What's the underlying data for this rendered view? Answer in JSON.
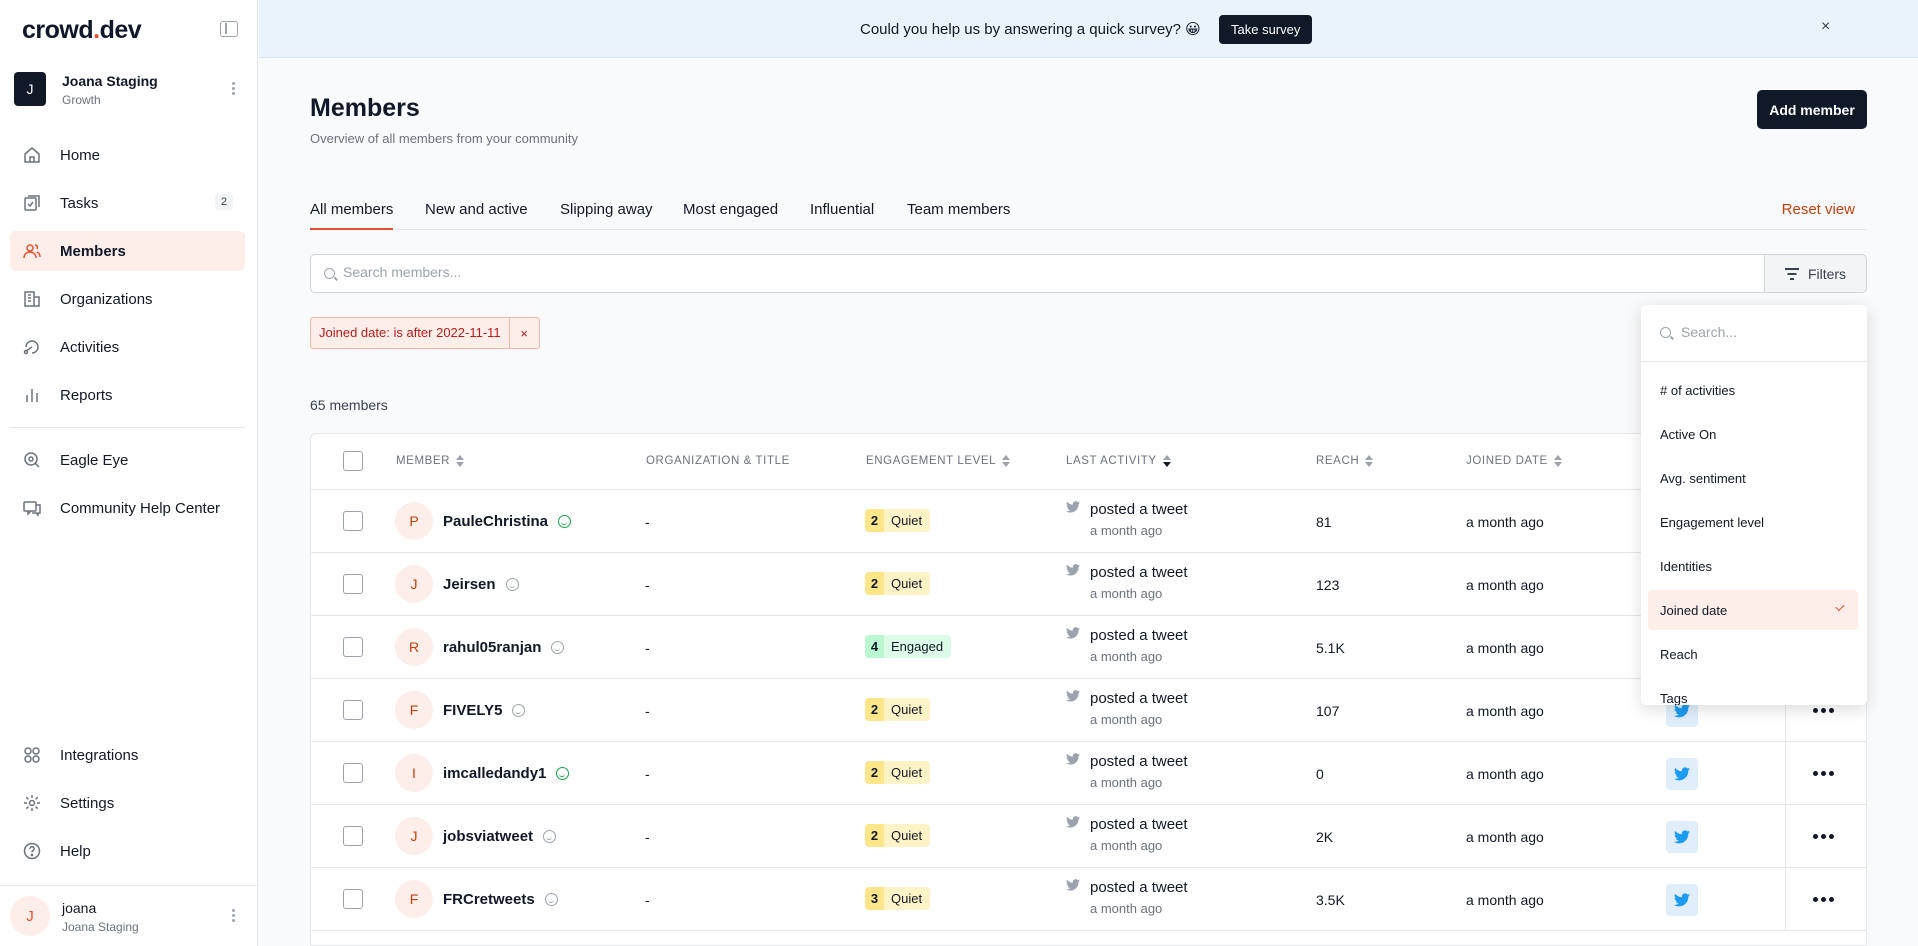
{
  "brand": {
    "logo_main": "crowd",
    "logo_dot": ".",
    "logo_tail": "dev",
    "accent": "#e94f2e"
  },
  "workspace": {
    "initial": "J",
    "name": "Joana Staging",
    "plan": "Growth"
  },
  "sidebar": {
    "items": [
      {
        "label": "Home",
        "icon": "home-icon"
      },
      {
        "label": "Tasks",
        "icon": "tasks-icon",
        "badge": "2"
      },
      {
        "label": "Members",
        "icon": "members-icon",
        "active": true
      },
      {
        "label": "Organizations",
        "icon": "organizations-icon"
      },
      {
        "label": "Activities",
        "icon": "activities-icon"
      },
      {
        "label": "Reports",
        "icon": "reports-icon"
      },
      {
        "label": "Eagle Eye",
        "icon": "eagle-eye-icon"
      },
      {
        "label": "Community Help Center",
        "icon": "help-center-icon"
      },
      {
        "label": "Integrations",
        "icon": "integrations-icon"
      },
      {
        "label": "Settings",
        "icon": "settings-icon"
      },
      {
        "label": "Help",
        "icon": "help-icon"
      }
    ]
  },
  "user": {
    "initial": "J",
    "name": "joana",
    "workspace": "Joana Staging"
  },
  "banner": {
    "text": "Could you help us by answering a quick survey? 😀",
    "button": "Take survey",
    "close": "×"
  },
  "header": {
    "title": "Members",
    "subtitle": "Overview of all members from your community",
    "add_button": "Add member"
  },
  "tabs": [
    "All members",
    "New and active",
    "Slipping away",
    "Most engaged",
    "Influential",
    "Team members"
  ],
  "reset_view": "Reset view",
  "search": {
    "placeholder": "Search members...",
    "filters_label": "Filters"
  },
  "active_filter": {
    "label": "Joined date:",
    "value": "is after 2022-11-11",
    "remove": "×"
  },
  "member_count": "65 members",
  "table": {
    "headers": {
      "member": "MEMBER",
      "organization": "ORGANIZATION & TITLE",
      "engagement": "ENGAGEMENT LEVEL",
      "last_activity": "LAST ACTIVITY",
      "reach": "REACH",
      "joined": "JOINED DATE"
    },
    "rows": [
      {
        "initial": "P",
        "name": "PauleChristina",
        "sentiment": "positive",
        "org": "-",
        "eng_num": "2",
        "eng_label": "Quiet",
        "activity": "posted a tweet",
        "activity_time": "a month ago",
        "reach": "81",
        "joined": "a month ago"
      },
      {
        "initial": "J",
        "name": "Jeirsen",
        "sentiment": "neutral",
        "org": "-",
        "eng_num": "2",
        "eng_label": "Quiet",
        "activity": "posted a tweet",
        "activity_time": "a month ago",
        "reach": "123",
        "joined": "a month ago"
      },
      {
        "initial": "R",
        "name": "rahul05ranjan",
        "sentiment": "neutral",
        "org": "-",
        "eng_num": "4",
        "eng_label": "Engaged",
        "activity": "posted a tweet",
        "activity_time": "a month ago",
        "reach": "5.1K",
        "joined": "a month ago"
      },
      {
        "initial": "F",
        "name": "FIVELY5",
        "sentiment": "neutral",
        "org": "-",
        "eng_num": "2",
        "eng_label": "Quiet",
        "activity": "posted a tweet",
        "activity_time": "a month ago",
        "reach": "107",
        "joined": "a month ago"
      },
      {
        "initial": "I",
        "name": "imcalledandy1",
        "sentiment": "positive",
        "org": "-",
        "eng_num": "2",
        "eng_label": "Quiet",
        "activity": "posted a tweet",
        "activity_time": "a month ago",
        "reach": "0",
        "joined": "a month ago"
      },
      {
        "initial": "J",
        "name": "jobsviatweet",
        "sentiment": "neutral",
        "org": "-",
        "eng_num": "2",
        "eng_label": "Quiet",
        "activity": "posted a tweet",
        "activity_time": "a month ago",
        "reach": "2K",
        "joined": "a month ago"
      },
      {
        "initial": "F",
        "name": "FRCretweets",
        "sentiment": "neutral",
        "org": "-",
        "eng_num": "3",
        "eng_label": "Quiet",
        "activity": "posted a tweet",
        "activity_time": "a month ago",
        "reach": "3.5K",
        "joined": "a month ago"
      }
    ]
  },
  "filter_dropdown": {
    "placeholder": "Search...",
    "options": [
      "# of activities",
      "Active On",
      "Avg. sentiment",
      "Engagement level",
      "Identities",
      "Joined date",
      "Reach",
      "Tags"
    ],
    "selected": "Joined date"
  }
}
